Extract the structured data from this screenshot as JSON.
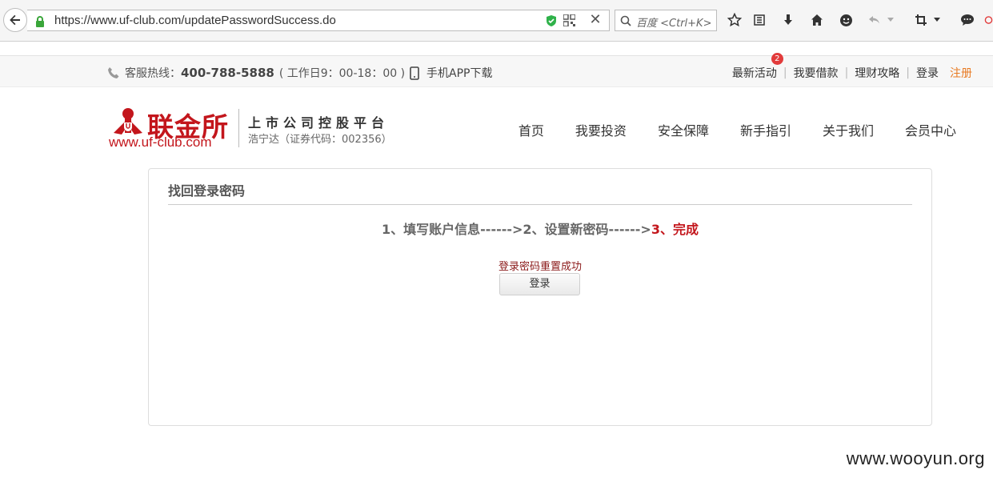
{
  "browser": {
    "url": "https://www.uf-club.com/updatePasswordSuccess.do",
    "search_placeholder": "百度 <Ctrl+K>"
  },
  "topbar": {
    "hotline_label": "客服热线：",
    "hotline_number": "400-788-5888",
    "hotline_hours": "( 工作日9：00-18：00 )",
    "app_download": "手机APP下载",
    "links": {
      "activities": "最新活动",
      "activities_badge": "2",
      "borrow": "我要借款",
      "strategy": "理财攻略",
      "login": "登录",
      "register": "注册"
    }
  },
  "header": {
    "logo_cn": "联金所",
    "logo_url": "www.uf-club.com",
    "tagline": "上市公司控股平台",
    "stock": "浩宁达（证券代码：002356）",
    "nav": {
      "home": "首页",
      "invest": "我要投资",
      "security": "安全保障",
      "guide": "新手指引",
      "about": "关于我们",
      "member": "会员中心"
    }
  },
  "panel": {
    "title": "找回登录密码",
    "step1": "1、填写账户信息------>",
    "step2": "2、设置新密码------>",
    "step3": "3、完成",
    "success_message": "登录密码重置成功",
    "login_button": "登录"
  },
  "watermark": "www.wooyun.org",
  "colors": {
    "brand_red": "#c3161c",
    "register_orange": "#e87a22",
    "badge_red": "#e23b3b"
  }
}
